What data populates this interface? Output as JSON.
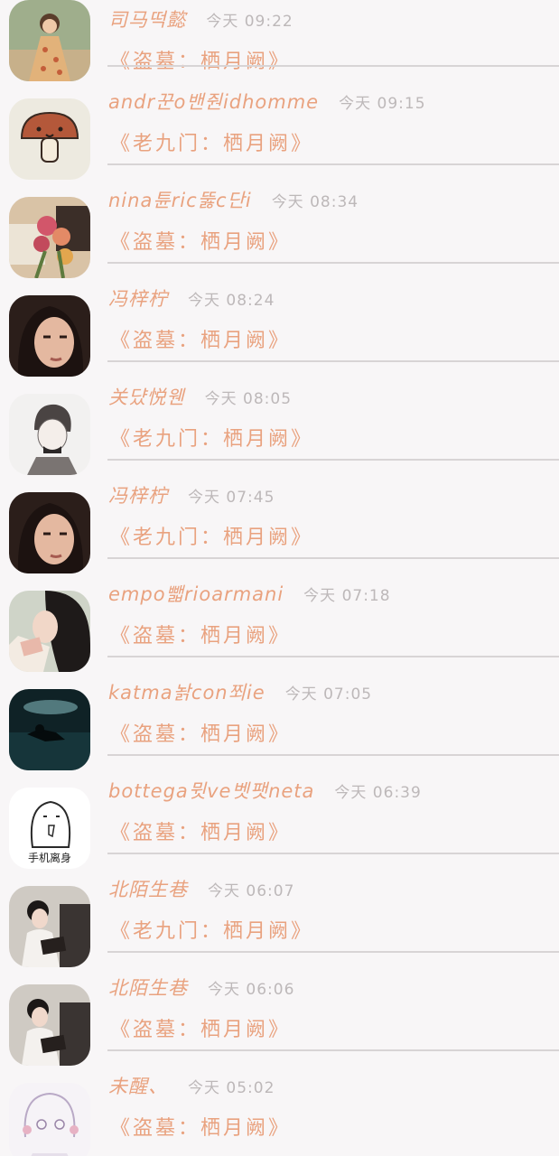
{
  "conversations": [
    {
      "name": "司马떡懿",
      "time": "今天 09:22",
      "message": "《盗墓：栖月阙》",
      "avatar_icon": "girl-in-floral-dress-avatar"
    },
    {
      "name": "andr꾼o밴줜idhomme",
      "time": "今天 09:15",
      "message": "《老九门：栖月阙》",
      "avatar_icon": "cartoon-mushroom-avatar"
    },
    {
      "name": "nina튠ric뚫c단i",
      "time": "今天 08:34",
      "message": "《盗墓：栖月阙》",
      "avatar_icon": "flower-bouquet-avatar"
    },
    {
      "name": "冯梓柠",
      "time": "今天 08:24",
      "message": "《盗墓：栖月阙》",
      "avatar_icon": "long-hair-portrait-avatar"
    },
    {
      "name": "关댰悦웬",
      "time": "今天 08:05",
      "message": "《老九门：栖月阙》",
      "avatar_icon": "sketch-boy-avatar"
    },
    {
      "name": "冯梓柠",
      "time": "今天 07:45",
      "message": "《老九门：栖月阙》",
      "avatar_icon": "long-hair-portrait-avatar"
    },
    {
      "name": "empo뺇rioarmani",
      "time": "今天 07:18",
      "message": "《盗墓：栖月阙》",
      "avatar_icon": "reading-girl-avatar"
    },
    {
      "name": "katma놝con쬐ie",
      "time": "今天 07:05",
      "message": "《盗墓：栖月阙》",
      "avatar_icon": "dark-water-scene-avatar"
    },
    {
      "name": "bottega뮛ve벳팻neta",
      "time": "今天 06:39",
      "message": "《盗墓：栖月阙》",
      "avatar_icon": "doodle-character-avatar",
      "avatar_caption": "手机离身"
    },
    {
      "name": "北陌生巷",
      "time": "今天 06:07",
      "message": "《老九门：栖月阙》",
      "avatar_icon": "girl-with-book-avatar"
    },
    {
      "name": "北陌生巷",
      "time": "今天 06:06",
      "message": "《盗墓：栖月阙》",
      "avatar_icon": "girl-with-book-avatar"
    },
    {
      "name": "未醒、",
      "time": "今天 05:02",
      "message": "《盗墓：栖月阙》",
      "avatar_icon": "anime-girl-sketch-avatar"
    }
  ],
  "colors": {
    "background": "#f8f6f7",
    "name_and_message": "#e9a27f",
    "timestamp": "#bdb8b9",
    "divider": "#d8d4d5"
  }
}
